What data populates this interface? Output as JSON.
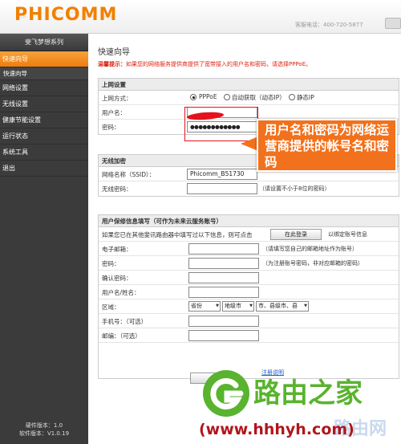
{
  "header": {
    "logo": "PHICOMM",
    "hotline": "客服电话：400-720-5877"
  },
  "sidebar": {
    "title": "斐飞梦想系列",
    "items": [
      {
        "label": "快速向导",
        "active": true
      },
      {
        "label": "快速向导",
        "sub": true
      },
      {
        "label": "网络设置"
      },
      {
        "label": "无线设置"
      },
      {
        "label": "健康节能设置"
      },
      {
        "label": "运行状态"
      },
      {
        "label": "系统工具"
      },
      {
        "label": "退出"
      }
    ],
    "hw_version": "硬件版本：1.0",
    "sw_version": "软件版本：V1.0.19"
  },
  "main": {
    "title": "快速向导",
    "tip_label": "温馨提示：",
    "tip_text": "如果您的网络服务提供商提供了宽带接入的用户名和密码，请选择PPPoE。",
    "internet": {
      "heading": "上网设置",
      "mode_label": "上网方式：",
      "modes": [
        "PPPoE",
        "自动获取（动态IP）",
        "静态IP"
      ],
      "selected_mode": "PPPoE",
      "username_label": "用户名：",
      "username_value": "",
      "password_label": "密码：",
      "password_value": "●●●●●●●●●●●●"
    },
    "wireless": {
      "heading": "无线加密",
      "ssid_label": "网络名称（SSID）：",
      "ssid_value": "Phicomm_B51730",
      "key_label": "无线密码：",
      "key_value": "",
      "key_hint": "（请设置不小于8位的密码）"
    },
    "cloud": {
      "heading": "用户保修信息填写（可作为未来云服务账号）",
      "intro": "如果您已在其他斐讯路由器中填写过以下信息，则可点击",
      "login_button": "在此登录",
      "bind_hint": "以绑定账号信息",
      "email_label": "电子邮箱：",
      "email_hint": "（请填写您自己的邮箱地址作为账号）",
      "password_label": "密码：",
      "password_hint": "（为注册账号密码，非对应邮箱的密码）",
      "confirm_label": "确认密码：",
      "name_label": "用户名/姓名：",
      "region_label": "区域：",
      "province": "省份",
      "city": "地级市",
      "county": "市、县级市、县",
      "phone_label": "手机号：（可选）",
      "zip_label": "邮编：（可选）",
      "register_link": "注册说明"
    }
  },
  "callout": {
    "text": "用户名和密码为网络运营商提供的帐号名和密码"
  },
  "watermark": {
    "brand": "路由之家",
    "url": "(www.hhhyh.com)",
    "ghost": "路由网"
  },
  "colors": {
    "accent": "#ed7d0e",
    "sidebar": "#3b3b3b",
    "tip": "#dd2211",
    "callout": "#f2711c",
    "watermark_green": "#59b32e",
    "watermark_red": "#b0161c"
  }
}
